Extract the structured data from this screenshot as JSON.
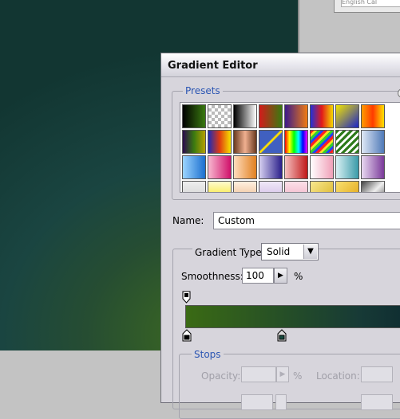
{
  "background": {
    "top_field_text": "English Cal"
  },
  "dialog": {
    "title": "Gradient Editor",
    "presets_legend": "Presets",
    "name_label": "Name:",
    "name_value": "Custom",
    "gradient_type_label": "Gradient Type:",
    "gradient_type_value": "Solid",
    "smoothness_label": "Smoothness:",
    "smoothness_value": "100",
    "smoothness_unit": "%",
    "stops_legend": "Stops",
    "opacity_label": "Opacity:",
    "opacity_unit": "%",
    "location_label": "Location:"
  },
  "presets": [
    "linear-gradient(90deg,#000,#3a7a10)",
    "repeating-conic-gradient(#bbb 0 25%,#fff 0 50%) 0 0/8px 8px",
    "linear-gradient(90deg,#000,#fff)",
    "linear-gradient(90deg,#d21b1b,#3a7a10)",
    "linear-gradient(90deg,#3b1a8a,#f07b14)",
    "linear-gradient(90deg,#2231d8,#e21a1a,#f5d800)",
    "linear-gradient(135deg,#f3e600,#1a23c8)",
    "linear-gradient(90deg,#ff9d00,#ff3b00,#ffe100)",
    "linear-gradient(90deg,#2b0a4c,#3a7a10,#b5a000)",
    "linear-gradient(90deg,#1b2bb8,#e03a10,#f5e300)",
    "linear-gradient(90deg,#6a3a20,#f0b090,#6a3a20)",
    "linear-gradient(135deg,#4060c0 45%,#ffe000 48%,#ffe000 52%,#4060c0 55%)",
    "linear-gradient(90deg,#ff0000,#ff0 20%,#0f0 40%,#0ff 60%,#00f 80%,#f0f)",
    "repeating-linear-gradient(135deg,#ff2020 0 3px,#f8e020 3px 6px,#30d030 6px 9px,#2040ff 9px 12px)",
    "repeating-linear-gradient(135deg,#2d7a1a 0 3px,#fff 3px 6px)",
    "linear-gradient(90deg,#dfe8f5,#4f79b8)",
    "linear-gradient(90deg,#9cd4ff,#1b6fcf)",
    "linear-gradient(90deg,#f7b8d0,#d0106a)",
    "linear-gradient(90deg,#ffdcbc,#e08020)",
    "linear-gradient(90deg,#d6d0f0,#2a1f8a)",
    "linear-gradient(90deg,#f5c0c0,#c01818)",
    "linear-gradient(90deg,#fff,#f0a0b8)",
    "linear-gradient(90deg,#d8f0f3,#3a9aa8)",
    "linear-gradient(90deg,#e8d8f0,#7a3a9a)",
    "linear-gradient(180deg,#eee,#ccc)",
    "linear-gradient(180deg,#fffbd0,#f5e000)",
    "linear-gradient(180deg,#fff0e0,#e8b080)",
    "linear-gradient(180deg,#f0e8f8,#c8b0e0)",
    "linear-gradient(180deg,#fbe0e8,#f0a8c0)",
    "linear-gradient(135deg,#f8e890,#d8b020)",
    "linear-gradient(135deg,#f8e070,#e0a010)",
    "linear-gradient(135deg,#444,#eee 50%,#444)"
  ]
}
